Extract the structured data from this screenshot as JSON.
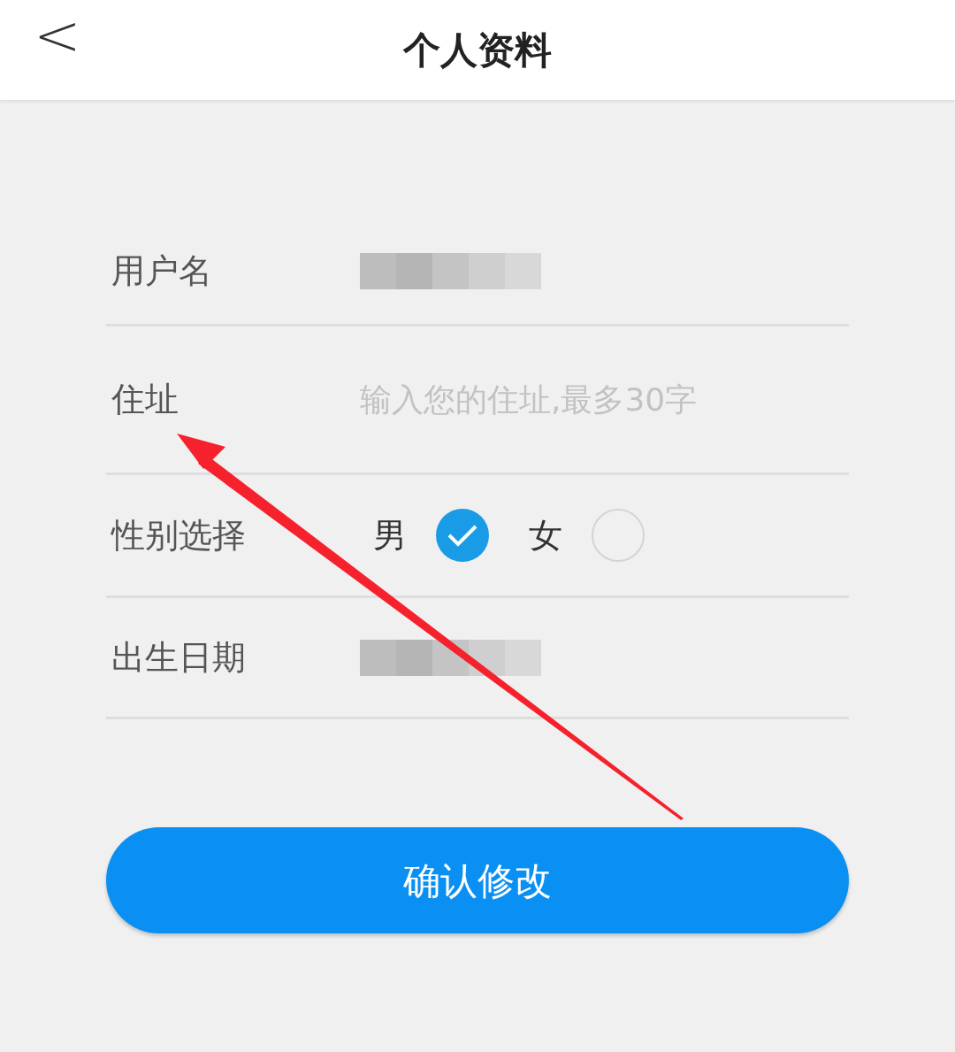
{
  "header": {
    "back": "<",
    "title": "个人资料"
  },
  "form": [
    {
      "kind": "redacted",
      "label": "用户名"
    },
    {
      "kind": "input",
      "label": "住址",
      "placeholder": "输入您的住址,最多30字"
    },
    {
      "kind": "radio",
      "label": "性别选择",
      "options": [
        {
          "label": "男",
          "selected": true
        },
        {
          "label": "女",
          "selected": false
        }
      ]
    },
    {
      "kind": "redacted",
      "label": "出生日期"
    }
  ],
  "submit": "确认修改"
}
